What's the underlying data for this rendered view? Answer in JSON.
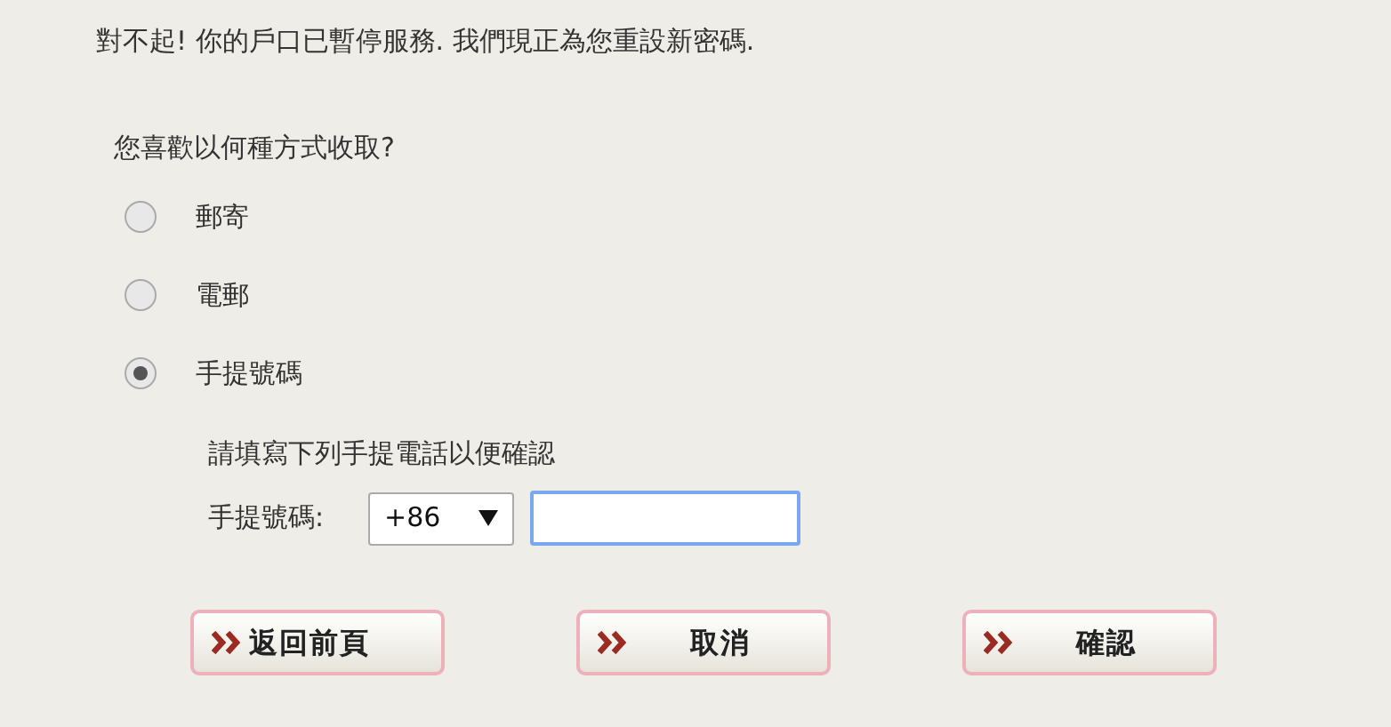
{
  "message": "對不起! 你的戶口已暫停服務. 我們現正為您重設新密碼.",
  "question": "您喜歡以何種方式收取?",
  "options": [
    {
      "label": "郵寄",
      "selected": false
    },
    {
      "label": "電郵",
      "selected": false
    },
    {
      "label": "手提號碼",
      "selected": true
    }
  ],
  "mobile": {
    "instruction": "請填寫下列手提電話以便確認",
    "label": "手提號碼:",
    "country_code": "+86",
    "phone_field": {
      "focused": true
    }
  },
  "buttons": [
    {
      "label": "返回前頁",
      "kind": "back"
    },
    {
      "label": "取消",
      "kind": "action"
    },
    {
      "label": "確認",
      "kind": "action"
    }
  ]
}
